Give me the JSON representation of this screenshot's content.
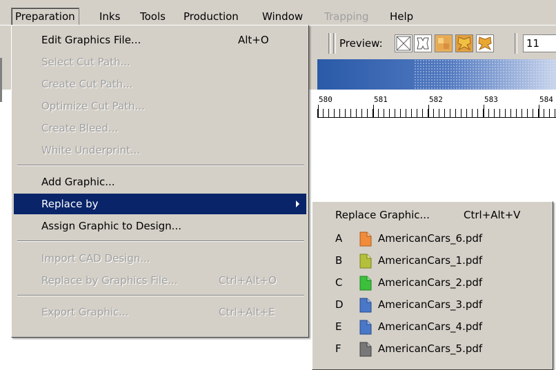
{
  "menubar": {
    "items": [
      {
        "label": "Preparation"
      },
      {
        "label": "Inks"
      },
      {
        "label": "Tools"
      },
      {
        "label": "Production"
      },
      {
        "label": "Window"
      },
      {
        "label": "Trapping"
      },
      {
        "label": "Help"
      }
    ]
  },
  "toolbar": {
    "preview_label": "Preview:",
    "zoom_value": "11"
  },
  "ruler": {
    "labels": [
      "580",
      "581",
      "582",
      "583",
      "584"
    ]
  },
  "menu": {
    "edit_graphics": {
      "label": "Edit Graphics File...",
      "shortcut": "Alt+O"
    },
    "select_cut": {
      "label": "Select Cut Path..."
    },
    "create_cut": {
      "label": "Create Cut Path..."
    },
    "optimize_cut": {
      "label": "Optimize Cut Path..."
    },
    "create_bleed": {
      "label": "Create Bleed..."
    },
    "white_underprint": {
      "label": "White Underprint..."
    },
    "add_graphic": {
      "label": "Add Graphic..."
    },
    "replace_by": {
      "label": "Replace by"
    },
    "assign_graphic": {
      "label": "Assign Graphic to Design..."
    },
    "import_cad": {
      "label": "Import CAD Design..."
    },
    "replace_graphics_file": {
      "label": "Replace by Graphics File...",
      "shortcut": "Ctrl+Alt+O"
    },
    "export_graphic": {
      "label": "Export Graphic...",
      "shortcut": "Ctrl+Alt+E"
    }
  },
  "submenu": {
    "replace_graphic": {
      "label": "Replace Graphic...",
      "shortcut": "Ctrl+Alt+V"
    },
    "files": [
      {
        "letter": "A",
        "name": "AmericanCars_6.pdf",
        "color": "#f08c3c"
      },
      {
        "letter": "B",
        "name": "AmericanCars_1.pdf",
        "color": "#b4c03c"
      },
      {
        "letter": "C",
        "name": "AmericanCars_2.pdf",
        "color": "#3cc03c"
      },
      {
        "letter": "D",
        "name": "AmericanCars_3.pdf",
        "color": "#4a78c8"
      },
      {
        "letter": "E",
        "name": "AmericanCars_4.pdf",
        "color": "#4a78c8"
      },
      {
        "letter": "F",
        "name": "AmericanCars_5.pdf",
        "color": "#787878"
      }
    ]
  }
}
